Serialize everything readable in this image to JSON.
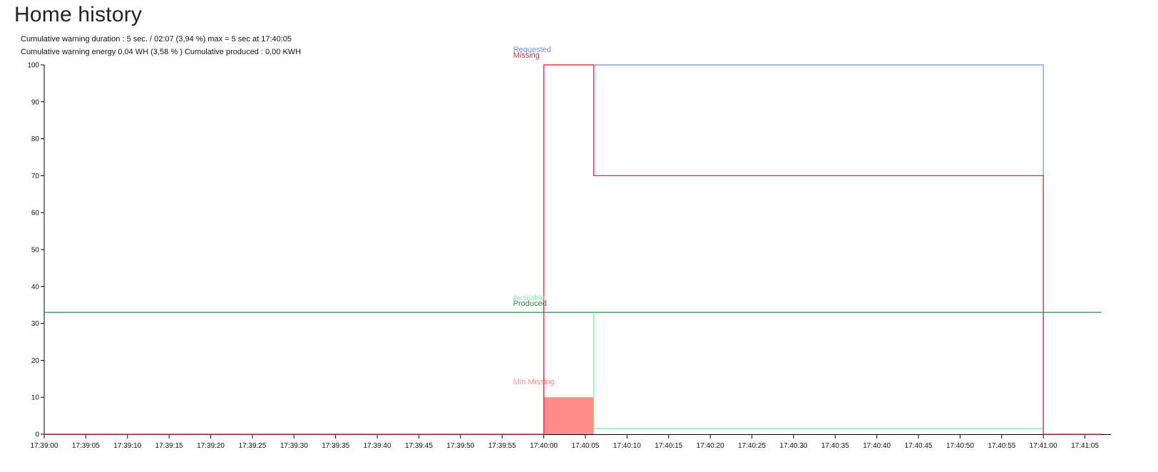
{
  "page": {
    "title": "Home history",
    "stats_line1": "Cumulative warning duration : 5 sec. / 02:07 (3,94 %) max = 5 sec at 17:40:05",
    "stats_line2": "Cumulative warning energy 0,04 WH (3,58 % ) Cumulative produced : 0,00 KWH"
  },
  "chart_data": {
    "type": "line",
    "title": "",
    "xlabel": "",
    "ylabel": "",
    "ylim": [
      0,
      100
    ],
    "xlim_seconds": [
      0,
      128
    ],
    "x_unit": "time (hh:mm:ss)",
    "x_ticks": [
      "17:39:00",
      "17:39:05",
      "17:39:10",
      "17:39:15",
      "17:39:20",
      "17:39:25",
      "17:39:30",
      "17:39:35",
      "17:39:40",
      "17:39:45",
      "17:39:50",
      "17:39:55",
      "17:40:00",
      "17:40:05",
      "17:40:10",
      "17:40:15",
      "17:40:20",
      "17:40:25",
      "17:40:30",
      "17:40:35",
      "17:40:40",
      "17:40:45",
      "17:40:50",
      "17:40:55",
      "17:41:00",
      "17:41:05"
    ],
    "y_ticks": [
      0,
      10,
      20,
      30,
      40,
      50,
      60,
      70,
      80,
      90,
      100
    ],
    "grid": false,
    "series": [
      {
        "name": "Requested",
        "color": "#6f8fcf",
        "step": true,
        "points": [
          [
            "17:39:00",
            0
          ],
          [
            "17:40:00",
            0
          ],
          [
            "17:40:00",
            100
          ],
          [
            "17:41:00",
            100
          ],
          [
            "17:41:00",
            0
          ],
          [
            "17:41:07",
            0
          ]
        ]
      },
      {
        "name": "Missing",
        "color": "#e8293f",
        "step": true,
        "points": [
          [
            "17:39:00",
            0
          ],
          [
            "17:40:00",
            0
          ],
          [
            "17:40:00",
            100
          ],
          [
            "17:40:06",
            100
          ],
          [
            "17:40:06",
            70
          ],
          [
            "17:41:00",
            70
          ],
          [
            "17:41:00",
            0
          ],
          [
            "17:41:07",
            0
          ]
        ]
      },
      {
        "name": "Available",
        "color": "#8fe8a8",
        "step": true,
        "points": [
          [
            "17:40:06",
            33
          ],
          [
            "17:40:06",
            1.5
          ],
          [
            "17:41:00",
            1.5
          ],
          [
            "17:41:00",
            33
          ]
        ]
      },
      {
        "name": "Produced",
        "color": "#2e8b3e",
        "step": true,
        "points": [
          [
            "17:39:00",
            33
          ],
          [
            "17:41:07",
            33
          ]
        ]
      },
      {
        "name": "Min Missing",
        "color": "#ff8a8a",
        "type": "area",
        "points": [
          [
            "17:40:00",
            10
          ],
          [
            "17:40:06",
            10
          ]
        ]
      }
    ]
  }
}
